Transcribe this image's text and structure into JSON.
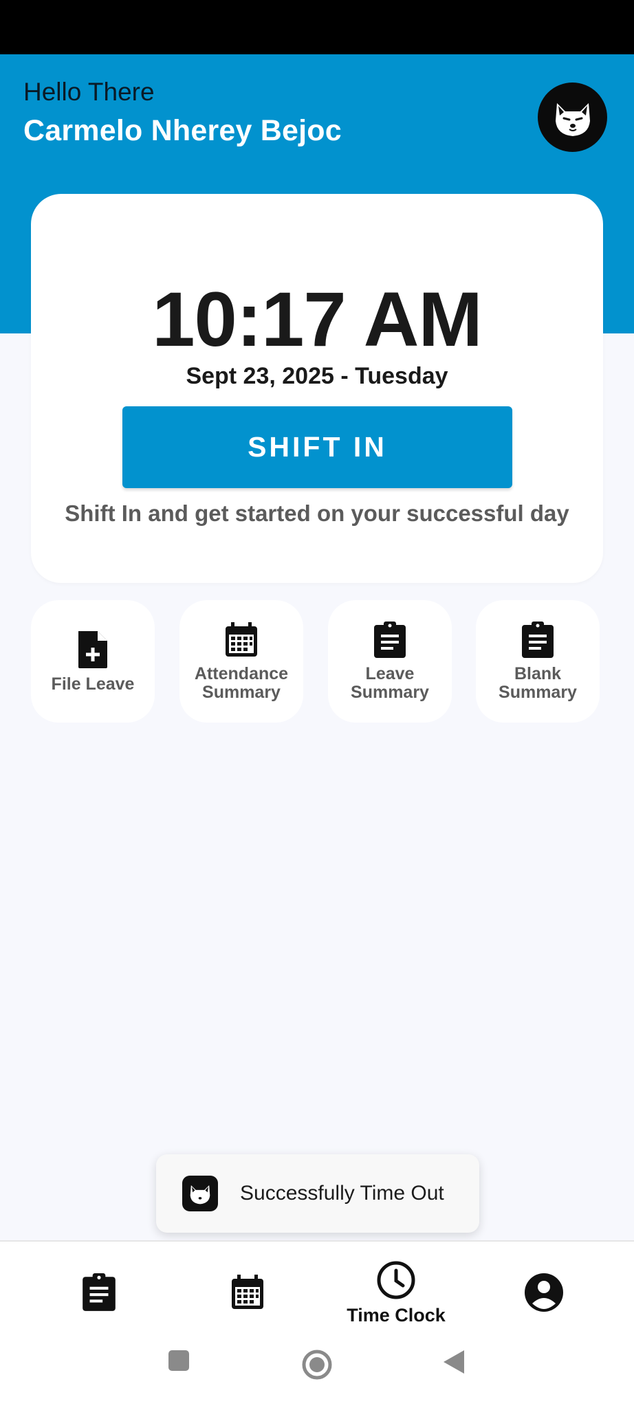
{
  "header": {
    "greeting": "Hello There",
    "user_name": "Carmelo Nherey Bejoc",
    "avatar_icon": "shiba-dog-icon",
    "color": "#0292ce"
  },
  "clock": {
    "time": "10:17 AM",
    "date": "Sept 23, 2025 - Tuesday",
    "shift_button_label": "SHIFT IN",
    "hint": "Shift In and get started on your successful day"
  },
  "quick_actions": [
    {
      "label_line1": "File Leave",
      "label_line2": "",
      "icon": "file-add-icon"
    },
    {
      "label_line1": "Attendance",
      "label_line2": "Summary",
      "icon": "calendar-icon"
    },
    {
      "label_line1": "Leave",
      "label_line2": "Summary",
      "icon": "clipboard-icon"
    },
    {
      "label_line1": "Blank",
      "label_line2": "Summary",
      "icon": "clipboard-icon"
    }
  ],
  "toast": {
    "message": "Successfully Time Out",
    "icon": "shiba-dog-icon"
  },
  "bottom_nav": [
    {
      "label": "",
      "icon": "clipboard-icon"
    },
    {
      "label": "",
      "icon": "calendar-icon"
    },
    {
      "label": "Time Clock",
      "icon": "clock-icon",
      "active": true
    },
    {
      "label": "",
      "icon": "account-circle-icon"
    }
  ],
  "system_nav": {
    "recents_icon": "square-icon",
    "home_icon": "circle-icon",
    "back_icon": "triangle-back-icon"
  }
}
